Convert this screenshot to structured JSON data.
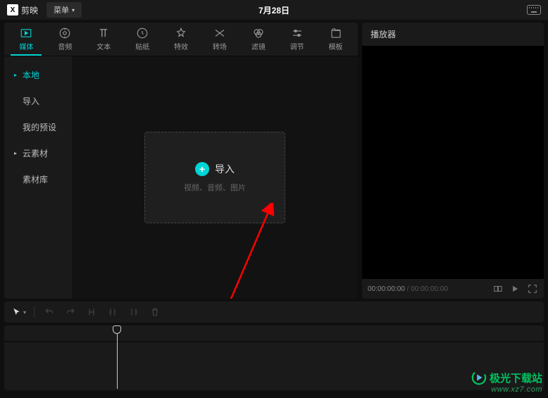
{
  "titlebar": {
    "app_name": "剪映",
    "menu_label": "菜单",
    "date_title": "7月28日"
  },
  "tabs": [
    {
      "label": "媒体"
    },
    {
      "label": "音频"
    },
    {
      "label": "文本"
    },
    {
      "label": "贴纸"
    },
    {
      "label": "特效"
    },
    {
      "label": "转场"
    },
    {
      "label": "滤镜"
    },
    {
      "label": "调节"
    },
    {
      "label": "模板"
    }
  ],
  "sidebar": {
    "items": [
      {
        "label": "本地",
        "expandable": true
      },
      {
        "label": "导入",
        "expandable": false
      },
      {
        "label": "我的预设",
        "expandable": false
      },
      {
        "label": "云素材",
        "expandable": true
      },
      {
        "label": "素材库",
        "expandable": false
      }
    ]
  },
  "import": {
    "label": "导入",
    "sub": "视频、音频、图片"
  },
  "player": {
    "title": "播放器",
    "time_current": "00:00:00:00",
    "time_separator": " / ",
    "time_total": "00:00:00:00"
  },
  "watermark": {
    "line1": "极光下载站",
    "line2": "www.xz7.com"
  }
}
